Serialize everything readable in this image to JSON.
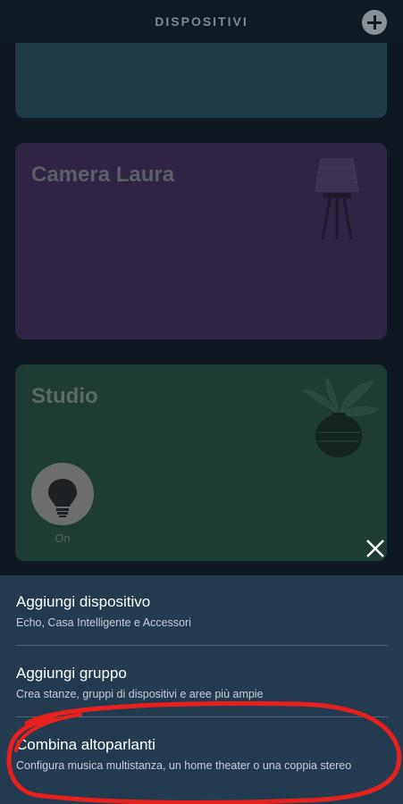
{
  "header": {
    "title": "DISPOSITIVI",
    "add_icon": "plus-circle-icon"
  },
  "rooms": [
    {
      "name": ""
    },
    {
      "name": "Camera Laura",
      "color": "#2f2443",
      "illustration": "floor-lamp-icon"
    },
    {
      "name": "Studio",
      "color": "#1d3c33",
      "illustration": "plant-vase-icon",
      "device": {
        "icon": "lightbulb-icon",
        "status": "On"
      }
    }
  ],
  "sheet": {
    "close_icon": "close-icon",
    "items": [
      {
        "label": "Aggiungi dispositivo",
        "sub": "Echo, Casa Intelligente e Accessori"
      },
      {
        "label": "Aggiungi gruppo",
        "sub": "Crea stanze, gruppi di dispositivi e aree più ampie"
      },
      {
        "label": "Combina altoparlanti",
        "sub": "Configura musica multistanza, un home theater o una coppia stereo"
      }
    ]
  },
  "annotation": {
    "color": "#e8211c",
    "shape": "freehand-circle"
  }
}
